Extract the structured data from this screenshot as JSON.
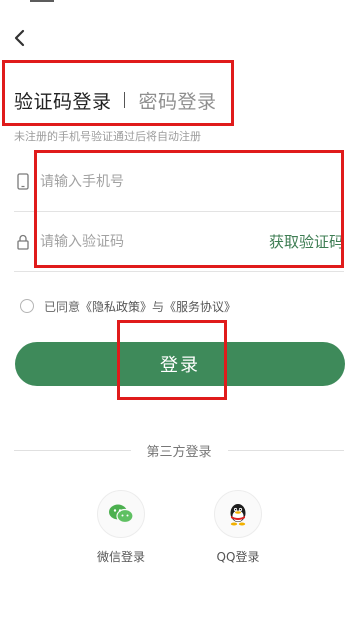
{
  "header": {
    "back_icon": "chevron-left-icon"
  },
  "login_tabs": {
    "active": "验证码登录",
    "inactive": "密码登录"
  },
  "hint": "未注册的手机号验证通过后将自动注册",
  "phone_field": {
    "icon": "phone-icon",
    "placeholder": "请输入手机号",
    "value": ""
  },
  "code_field": {
    "icon": "lock-icon",
    "placeholder": "请输入验证码",
    "value": "",
    "get_code_label": "获取验证码"
  },
  "agreement": {
    "checked": false,
    "prefix": "已同意",
    "privacy_link": "《隐私政策》",
    "connector": "与",
    "service_link": "《服务协议》"
  },
  "login_button": {
    "label": "登录"
  },
  "third_party": {
    "label": "第三方登录",
    "providers": [
      {
        "label": "微信登录",
        "icon": "wechat-icon"
      },
      {
        "label": "QQ登录",
        "icon": "qq-icon"
      }
    ]
  },
  "colors": {
    "accent": "#3e8a5a",
    "link_green": "#3e7d53",
    "highlight_red": "#e01b1b"
  }
}
